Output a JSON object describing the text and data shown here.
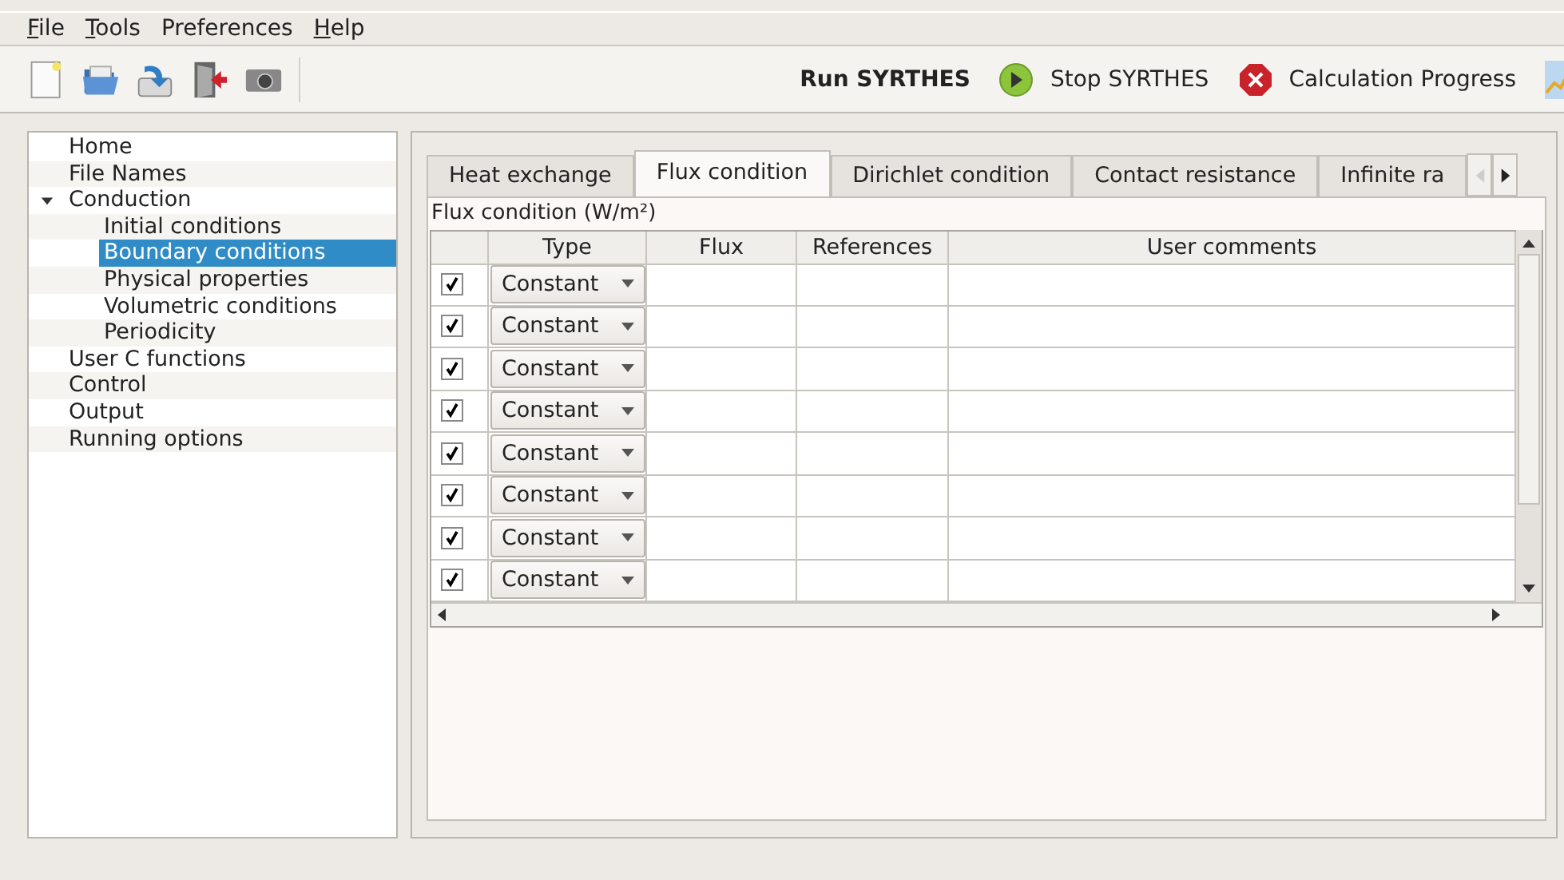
{
  "menu": [
    {
      "label": "File",
      "underlined": true
    },
    {
      "label": "Tools",
      "underlined": true
    },
    {
      "label": "Preferences",
      "underlined": false
    },
    {
      "label": "Help",
      "underlined": true
    }
  ],
  "toolbar": {
    "actions": [
      {
        "label": "Run SYRTHES",
        "kind": "run"
      },
      {
        "label": "Stop SYRTHES",
        "kind": "play"
      },
      {
        "label": "Calculation Progress",
        "kind": "stop"
      }
    ]
  },
  "tree": [
    {
      "label": "Home",
      "selected": false
    },
    {
      "label": "File Names",
      "selected": false
    },
    {
      "label": "Conduction",
      "selected": false,
      "expanded": true,
      "children": [
        {
          "label": "Initial conditions",
          "selected": false
        },
        {
          "label": "Boundary conditions",
          "selected": true
        },
        {
          "label": "Physical properties",
          "selected": false
        },
        {
          "label": "Volumetric conditions",
          "selected": false
        },
        {
          "label": "Periodicity",
          "selected": false
        }
      ]
    },
    {
      "label": "User C functions",
      "selected": false
    },
    {
      "label": "Control",
      "selected": false
    },
    {
      "label": "Output",
      "selected": false
    },
    {
      "label": "Running options",
      "selected": false
    }
  ],
  "tabs": [
    {
      "label": "Heat exchange",
      "selected": false
    },
    {
      "label": "Flux condition",
      "selected": true
    },
    {
      "label": "Dirichlet condition",
      "selected": false
    },
    {
      "label": "Contact resistance",
      "selected": false
    },
    {
      "label": "Infinite ra",
      "selected": false
    }
  ],
  "section_label": "Flux condition (W/m²)",
  "table": {
    "columns": [
      "Type",
      "Flux",
      "References",
      "User comments"
    ],
    "rows": [
      {
        "checked": true,
        "type": "Constant"
      },
      {
        "checked": true,
        "type": "Constant"
      },
      {
        "checked": true,
        "type": "Constant"
      },
      {
        "checked": true,
        "type": "Constant"
      },
      {
        "checked": true,
        "type": "Constant"
      },
      {
        "checked": true,
        "type": "Constant"
      },
      {
        "checked": true,
        "type": "Constant"
      },
      {
        "checked": true,
        "type": "Constant"
      }
    ]
  }
}
